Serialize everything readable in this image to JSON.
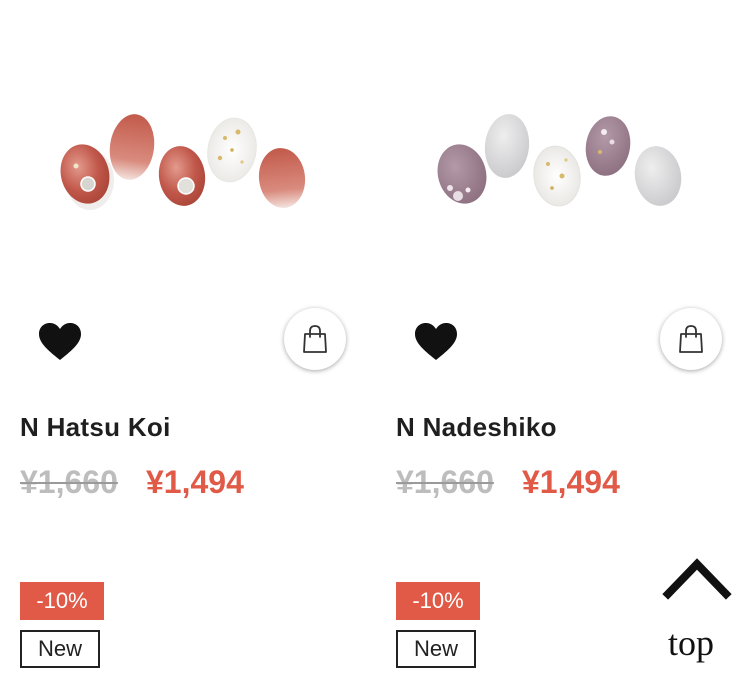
{
  "products": [
    {
      "name": "N Hatsu Koi",
      "original_price": "¥1,660",
      "sale_price": "¥1,494",
      "discount_badge": "-10%",
      "new_badge": "New",
      "image": "nail-set-red-clear"
    },
    {
      "name": "N Nadeshiko",
      "original_price": "¥1,660",
      "sale_price": "¥1,494",
      "discount_badge": "-10%",
      "new_badge": "New",
      "image": "nail-set-mauve-gray"
    }
  ],
  "icons": {
    "favorite": "heart-icon",
    "cart": "shopping-bag-icon",
    "top": "chevron-up-icon"
  },
  "top_button": {
    "label": "top"
  },
  "colors": {
    "sale_price": "#e05a47",
    "discount_badge_bg": "#e05a47",
    "strike_price": "#bdbdbd",
    "text": "#1f1f1f"
  }
}
